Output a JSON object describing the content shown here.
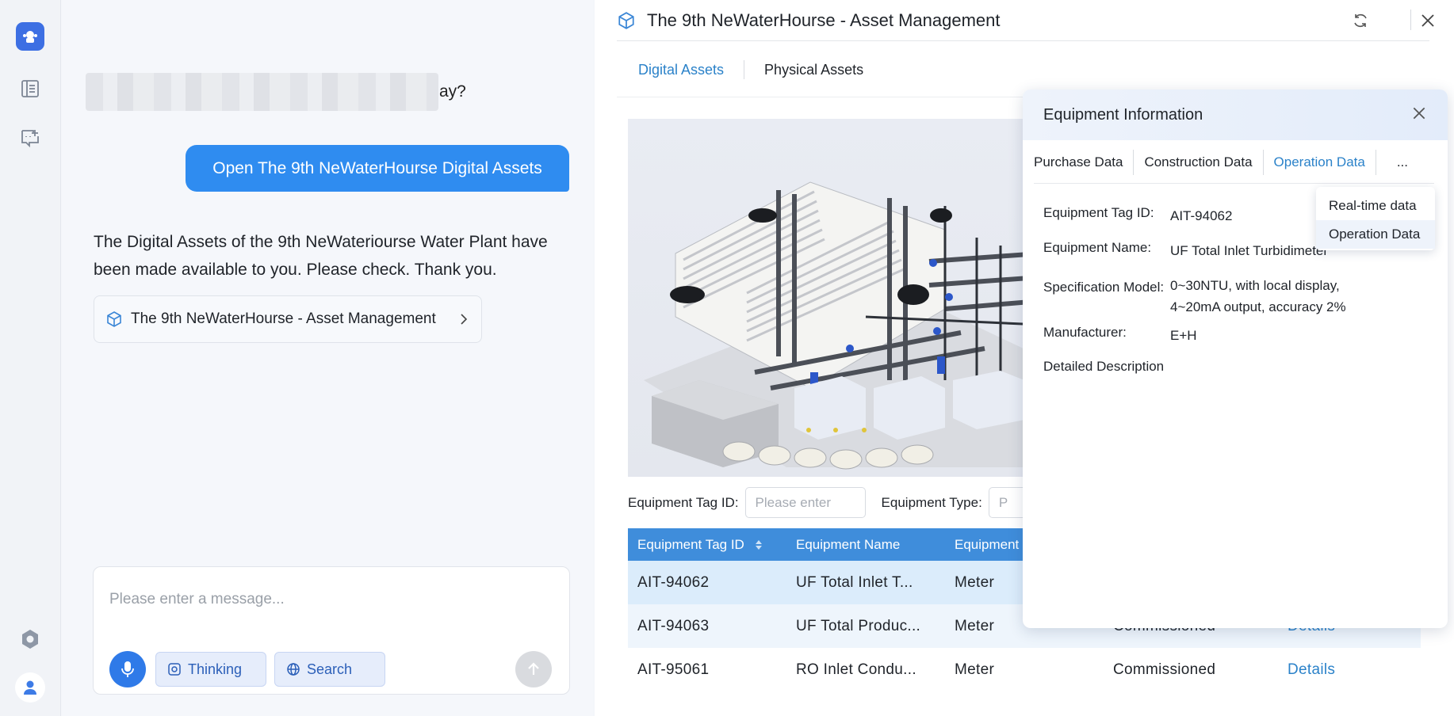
{
  "chat": {
    "question_tail": "ay?",
    "user_message": "Open The 9th NeWaterHourse Digital Assets",
    "reply_text": "The Digital Assets of the 9th NeWateriourse Water Plant have been made available to you. Please check. Thank you.",
    "asset_link_label": "The 9th NeWaterHourse - Asset Management",
    "composer_placeholder": "Please enter a message...",
    "thinking_label": "Thinking",
    "search_label": "Search"
  },
  "asset": {
    "title": "The 9th NeWaterHourse - Asset Management",
    "tabs": [
      {
        "label": "Digital Assets",
        "active": true
      },
      {
        "label": "Physical Assets",
        "active": false
      }
    ],
    "filters": {
      "tag_label": "Equipment Tag ID:",
      "tag_placeholder": "Please enter",
      "type_label": "Equipment Type:",
      "type_placeholder": "P"
    },
    "table": {
      "headers": [
        "Equipment Tag ID",
        "Equipment Name",
        "Equipment"
      ],
      "rows": [
        {
          "tag": "AIT-94062",
          "name": "UF Total Inlet T...",
          "type": "Meter",
          "status": "",
          "action": ""
        },
        {
          "tag": "AIT-94063",
          "name": "UF Total Produc...",
          "type": "Meter",
          "status": "Commissioned",
          "action": "Details"
        },
        {
          "tag": "AIT-95061",
          "name": "RO Inlet Condu...",
          "type": "Meter",
          "status": "Commissioned",
          "action": "Details"
        }
      ]
    }
  },
  "card": {
    "title": "Equipment Information",
    "tabs": [
      {
        "label": "Purchase Data",
        "active": false
      },
      {
        "label": "Construction Data",
        "active": false
      },
      {
        "label": "Operation Data",
        "active": true
      }
    ],
    "more_label": "...",
    "fields": {
      "tag_label": "Equipment Tag ID:",
      "tag_value": "AIT-94062",
      "name_label": "Equipment Name:",
      "name_value": "UF Total Inlet Turbidimeter",
      "spec_label": "Specification Model:",
      "spec_value_1": "0~30NTU, with local display,",
      "spec_value_2": "4~20mA output, accuracy 2%",
      "mfr_label": "Manufacturer:",
      "mfr_value": "E+H",
      "desc_label": "Detailed Description"
    },
    "dropdown": [
      "Real-time data",
      "Operation Data"
    ]
  }
}
